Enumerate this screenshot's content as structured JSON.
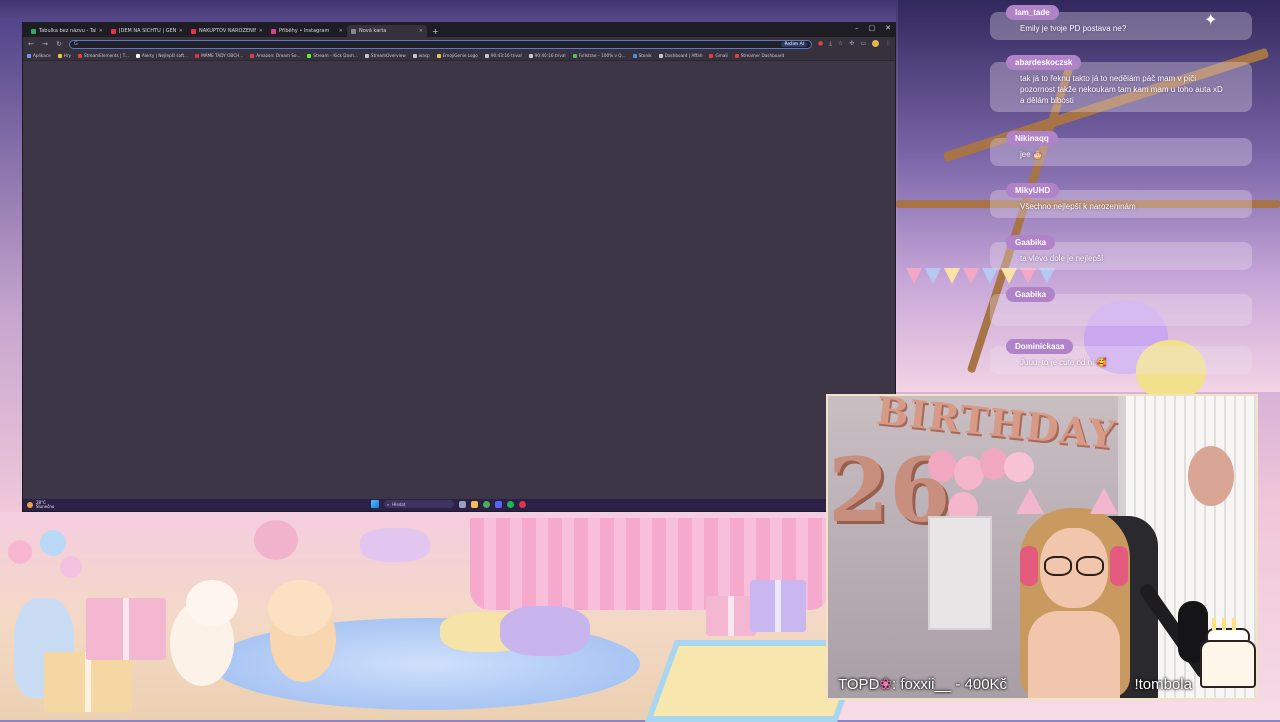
{
  "browser": {
    "tabs": [
      {
        "label": "Tabulka bez názvu - Tabulky Go",
        "color": "#2fa86b",
        "active": false
      },
      {
        "label": "JDEM NA ŠICHTU | GENE",
        "color": "#e0344a",
        "active": false
      },
      {
        "label": "NAKUPTOV NAROZENINOVÝ ST",
        "color": "#e0344a",
        "active": false
      },
      {
        "label": "Příběhy • Instagram",
        "color": "#d9408e",
        "active": false
      },
      {
        "label": "Nová karta",
        "color": "#8a8794",
        "active": true
      }
    ],
    "new_tab": "+",
    "window_controls": {
      "minimize": "–",
      "maximize": "□",
      "close": "✕"
    },
    "address_value": "",
    "ai_label": "Režim AI",
    "bookmarks": [
      {
        "label": "Aplikace",
        "color": "#6f9bea"
      },
      {
        "label": "Hry",
        "color": "#e8c54a"
      },
      {
        "label": "StreamElements | T...",
        "color": "#e04040"
      },
      {
        "label": "Alerty | Nejlepší soft...",
        "color": "#ffffff"
      },
      {
        "label": "MÁME TADY OBCH...",
        "color": "#e0344a"
      },
      {
        "label": "Amazon: Dream So...",
        "color": "#e04040"
      },
      {
        "label": "Stream – Kick Dash...",
        "color": "#53fc18"
      },
      {
        "label": "StreamOverview",
        "color": "#c9c5d0"
      },
      {
        "label": "wasp",
        "color": "#c9c5d0"
      },
      {
        "label": "EmojiGenie Logo",
        "color": "#e8c54a"
      },
      {
        "label": "90:43:16 trival",
        "color": "#c9c5d0"
      },
      {
        "label": "90:40:16 trival",
        "color": "#c9c5d0"
      },
      {
        "label": "Fullstrae – 100% v Q...",
        "color": "#53c25a"
      },
      {
        "label": "Stonik",
        "color": "#4f8de0"
      },
      {
        "label": "Dashboard | Affah",
        "color": "#c9c5d0"
      },
      {
        "label": "Gmail",
        "color": "#e04040"
      },
      {
        "label": "Streamer Dashboard",
        "color": "#e04040"
      }
    ]
  },
  "taskbar": {
    "weather_temp": "28°C",
    "weather_desc": "Slunečno",
    "search_placeholder": "Hledat",
    "tray": "⌃"
  },
  "chat": {
    "messages": [
      {
        "user": "Iam_tade",
        "text": "Emily je tvoje PD postava ne?"
      },
      {
        "user": "abardeskoczsk",
        "text": "tak já to řeknu takto já to nedělám páč mam v píči pozornost takže nekoukam tam kam mam u toho auta xD a dělám bibosti"
      },
      {
        "user": "Nikinaqq",
        "text": "jee 🎂"
      },
      {
        "user": "MikyUHD",
        "text": "Všechno nejlepší k narozeninám"
      },
      {
        "user": "Gaabika",
        "text": "ta vlevo dole je nejlepší"
      },
      {
        "user": "Gaabika",
        "text": ""
      },
      {
        "user": "Dominickaaa",
        "text": "Juuu, to je cute od ní 🥰"
      }
    ]
  },
  "webcam": {
    "banner": "BIRTHDAY",
    "number": "26",
    "caption_prefix": "TOPD",
    "caption_icon": "❀",
    "caption_rest": ": foxxii__ - 400Kč",
    "command": "!tombola"
  },
  "colors": {
    "chat_name_bg": "#b083c9",
    "browser_bg": "#3c3647",
    "cam_border": "#f2e3c6"
  }
}
